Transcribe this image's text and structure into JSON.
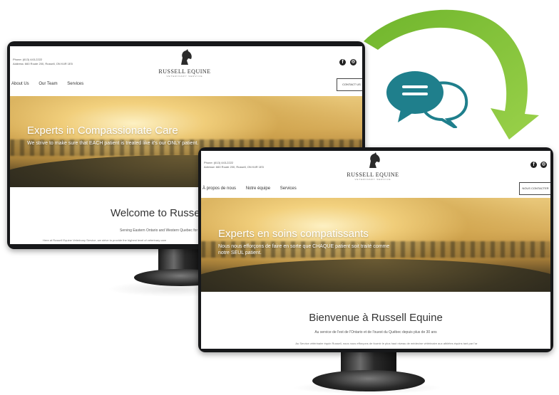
{
  "colors": {
    "arrow_green": "#8cc63f",
    "bubble_teal": "#1f7f8c",
    "bezel": "#17181a",
    "hero_gold": "#d8ae5c"
  },
  "icons": {
    "arrow": "curved-arrow-icon",
    "chat": "chat-bubbles-icon",
    "facebook": "facebook-icon",
    "instagram": "instagram-icon",
    "logo": "horse-head-logo-icon"
  },
  "english_site": {
    "contact_lines": [
      "Phone: (613) 443-2222",
      "Address: 660 Route 200, Russell, ON K4R 1E5"
    ],
    "logo_name": "RUSSELL EQUINE",
    "logo_sub": "VETERINARY SERVICE",
    "nav": [
      "About Us",
      "Our Team",
      "Services"
    ],
    "cta": "CONTACT US",
    "hero_title": "Experts in Compassionate Care",
    "hero_text": "We strive to make sure that EACH patient is treated like it's our ONLY patient.",
    "welcome": "Welcome to Russell Equine",
    "serving": "Serving Eastern Ontario and Western Quebec for over 30 years",
    "body": "Here at Russell Equine Veterinary Service, we strive to provide the highest level of veterinary care"
  },
  "french_site": {
    "contact_lines": [
      "Phone: (613) 443-2222",
      "Adresse: 660 Route 200, Russell, ON K4R 1E5"
    ],
    "logo_name": "RUSSELL EQUINE",
    "logo_sub": "VETERINARY SERVICE",
    "nav": [
      "À propos de nous",
      "Notre équipe",
      "Services"
    ],
    "cta": "NOUS CONTACTER",
    "hero_title": "Experts en soins compatissants",
    "hero_text": "Nous nous efforçons de faire en sorte que CHAQUE patient soit traité comme notre SEUL patient.",
    "welcome": "Bienvenue à Russell Equine",
    "serving": "Au service de l'est de l'Ontario et de l'ouest du Québec depuis plus de 30 ans",
    "body": "Au Service vétérinaire équin Russell, nous nous efforçons de fournir le plus haut niveau de médecine vétérinaire aux athlètes équins tant par l'ar"
  }
}
